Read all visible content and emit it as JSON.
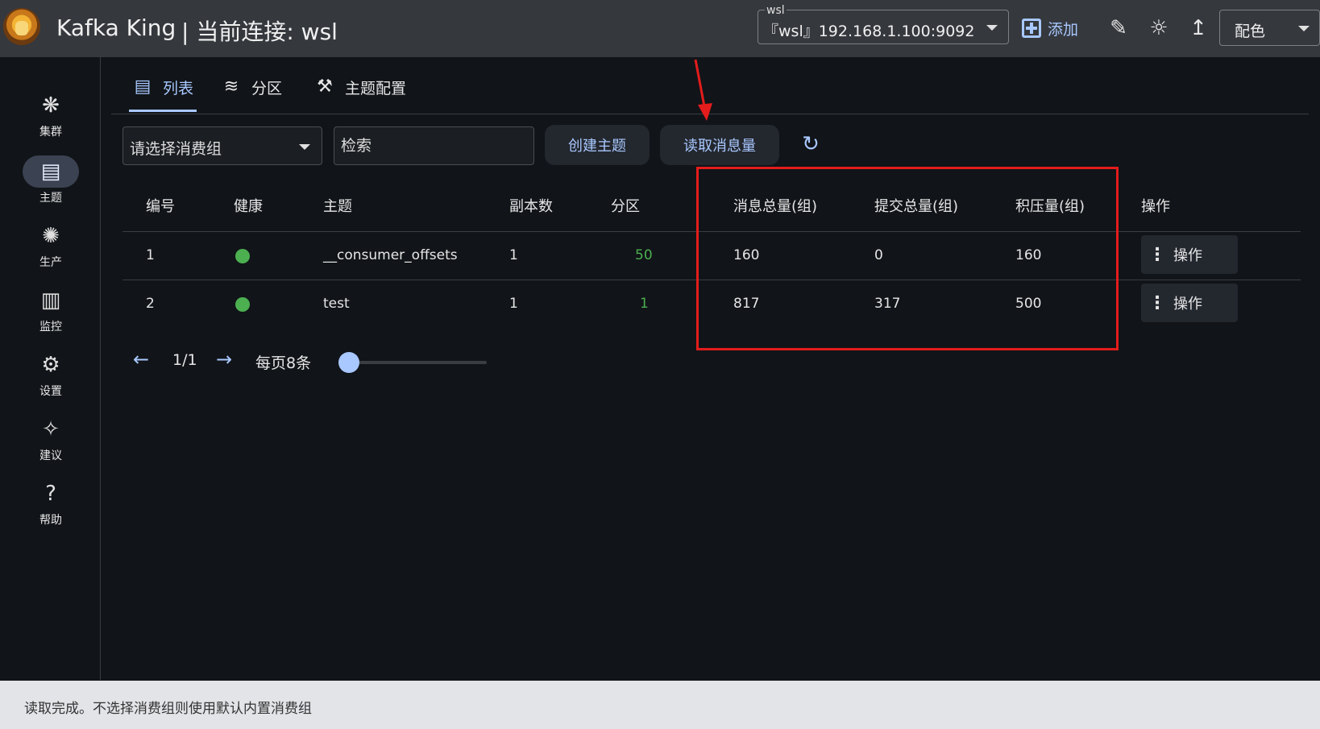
{
  "header": {
    "app_name": "Kafka King",
    "connection_label": "| 当前连接: wsl",
    "connection_select": {
      "small_label": "wsl",
      "value": "『wsl』192.168.1.100:9092"
    },
    "add_label": "添加",
    "color_select": "配色"
  },
  "sidebar": {
    "items": [
      {
        "label": "集群",
        "icon": "cluster-icon"
      },
      {
        "label": "主题",
        "icon": "topic-icon"
      },
      {
        "label": "生产",
        "icon": "produce-icon"
      },
      {
        "label": "监控",
        "icon": "monitor-icon"
      },
      {
        "label": "设置",
        "icon": "settings-icon"
      },
      {
        "label": "建议",
        "icon": "suggest-icon"
      },
      {
        "label": "帮助",
        "icon": "help-icon"
      }
    ],
    "active": "主题"
  },
  "tabs": [
    {
      "label": "列表",
      "icon": "list-icon"
    },
    {
      "label": "分区",
      "icon": "partition-icon"
    },
    {
      "label": "主题配置",
      "icon": "tools-icon"
    }
  ],
  "toolbar": {
    "group_placeholder": "请选择消费组",
    "search_placeholder": "检索",
    "create_topic": "创建主题",
    "read_messages": "读取消息量"
  },
  "table": {
    "columns": [
      "编号",
      "健康",
      "主题",
      "副本数",
      "分区",
      "消息总量(组)",
      "提交总量(组)",
      "积压量(组)",
      "操作"
    ],
    "rows": [
      {
        "id": "1",
        "topic": "__consumer_offsets",
        "replicas": "1",
        "partitions": "50",
        "total": "160",
        "committed": "0",
        "lag": "160",
        "action": "操作"
      },
      {
        "id": "2",
        "topic": "test",
        "replicas": "1",
        "partitions": "1",
        "total": "817",
        "committed": "317",
        "lag": "500",
        "action": "操作"
      }
    ]
  },
  "pagination": {
    "page": "1/1",
    "per_page": "每页8条"
  },
  "status": "读取完成。不选择消费组则使用默认内置消费组",
  "colors": {
    "accent": "#a8c8ff",
    "health_ok": "#4caf50",
    "annotation": "#e41c1c"
  }
}
